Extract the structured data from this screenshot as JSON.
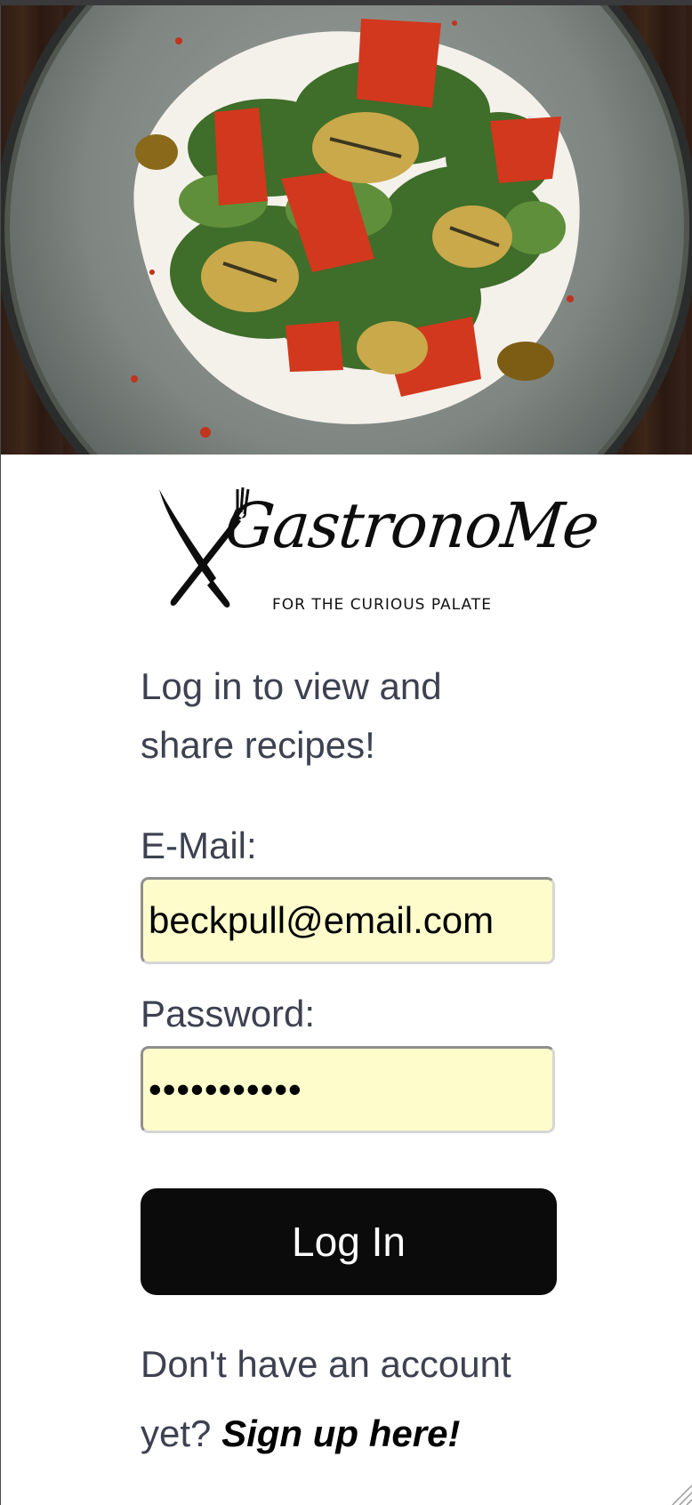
{
  "hero": {
    "image_icon": "salad-plate-photo"
  },
  "logo": {
    "brand": "GastronoMe",
    "tagline": "FOR THE CURIOUS PALATE",
    "icon": "crossed-knife-fork-icon"
  },
  "intro": {
    "text": "Log in to view and share recipes!"
  },
  "form": {
    "email_label": "E-Mail:",
    "email_value": "beckpull@email.com",
    "password_label": "Password:",
    "password_value": "•••••••••••",
    "submit_label": "Log In"
  },
  "signup": {
    "prompt": "Don't have an account yet? ",
    "link_label": "Sign up here!"
  },
  "colors": {
    "field_bg": "#fffccc",
    "button_bg": "#0b0b0c",
    "text": "#3d4150"
  }
}
